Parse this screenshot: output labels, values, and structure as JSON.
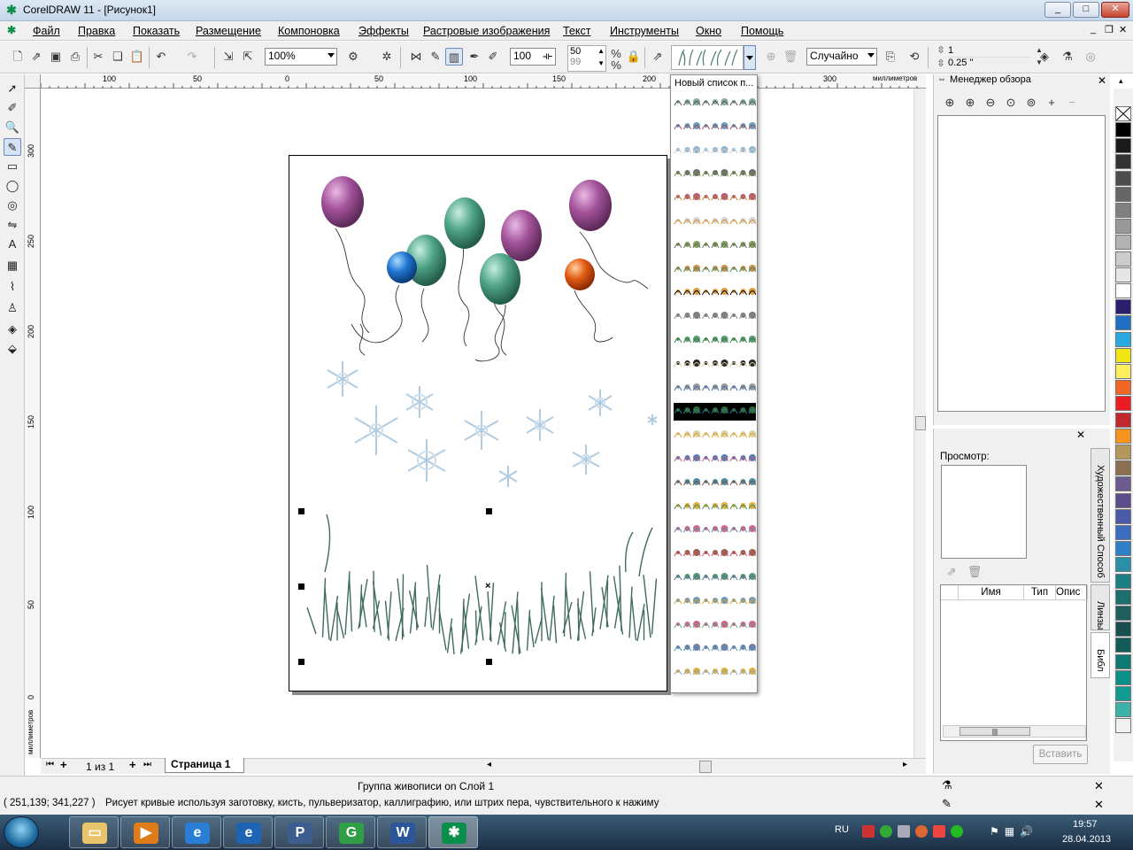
{
  "window": {
    "title": "CorelDRAW 11 - [Рисунок1]",
    "minimize": "_",
    "maximize": "□",
    "close": "✕"
  },
  "menu": [
    "Файл",
    "Правка",
    "Показать",
    "Размещение",
    "Компоновка",
    "Эффекты",
    "Растровые изображения",
    "Текст",
    "Инструменты",
    "Окно",
    "Помощь"
  ],
  "toolbar": {
    "zoom_value": "100%",
    "stroke_width": "100",
    "spin_a": "50",
    "spin_b": "99",
    "random_mode": "Случайно",
    "size_value": "1",
    "outline_value": "0.25 \""
  },
  "ruler": {
    "unit": "миллиметров",
    "h_ticks": [
      "100",
      "50",
      "0",
      "50",
      "100",
      "150",
      "200",
      "300"
    ],
    "v_ticks": [
      "300",
      "250",
      "200",
      "150",
      "100",
      "50",
      "0"
    ]
  },
  "stroke_list": {
    "title": "Новый список п..."
  },
  "docker_navigator": {
    "title": "Менеджер обзора"
  },
  "docker_art": {
    "preview_label": "Просмотр:",
    "columns": [
      "Имя",
      "Тип",
      "Опис"
    ],
    "insert_button": "Вставить",
    "tabs": [
      "Художественный Способ",
      "Линзы",
      "Библ"
    ]
  },
  "page_nav": {
    "counter": "1 из 1",
    "tab": "Страница 1"
  },
  "status": {
    "object_info": "Группа живописи on Слой 1",
    "coords": "( 251,139; 341,227 )",
    "hint": "Рисует кривые используя заготовку, кисть, пульверизатор, каллиграфию, или штрих пера, чувствительного к нажиму"
  },
  "taskbar": {
    "lang": "RU",
    "time": "19:57",
    "date": "28.04.2013"
  },
  "colors": {
    "palette": [
      "#000000",
      "#1a1a1a",
      "#333333",
      "#4d4d4d",
      "#666666",
      "#808080",
      "#999999",
      "#b3b3b3",
      "#cccccc",
      "#e6e6e6",
      "#ffffff",
      "#2a1f6e",
      "#1e6fc4",
      "#27a9e1",
      "#f0e613",
      "#ffef5f",
      "#f26522",
      "#ed1c24",
      "#c1272d",
      "#f7941d",
      "#b4975a",
      "#8b6f4e",
      "#6d5b8f",
      "#5b4c8c",
      "#4a5aa8",
      "#3c6cc0",
      "#2e80c8",
      "#2a8fa8",
      "#1d7f86",
      "#1d6f6e",
      "#1c5f5e",
      "#17504f",
      "#125b57",
      "#0d7a74",
      "#0b8f8a",
      "#109c94",
      "#3bb3a8",
      "#f0f0f0"
    ]
  }
}
